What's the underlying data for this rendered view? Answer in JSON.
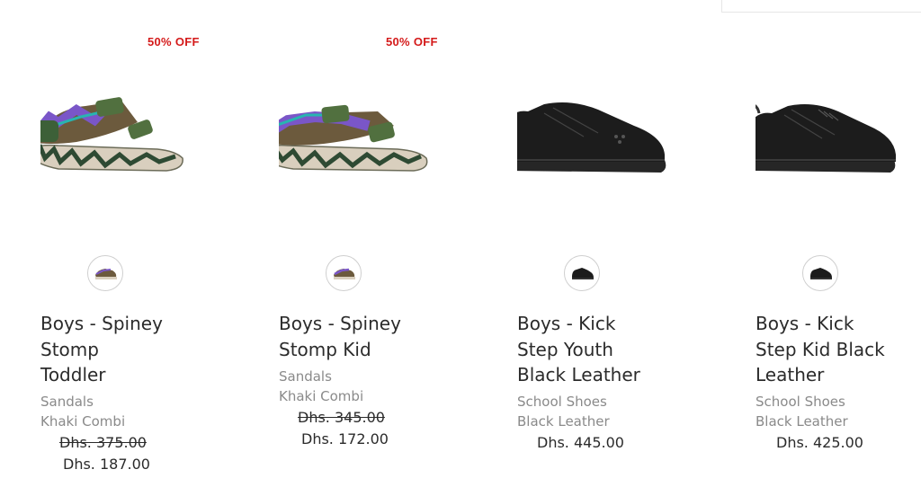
{
  "products": [
    {
      "badge": "50% OFF",
      "name": "Boys - Spiney Stomp Toddler",
      "name_lines": [
        "Boys - Spiney",
        "Stomp",
        "Toddler"
      ],
      "category": "Sandals",
      "color": "Khaki Combi",
      "price_original": "Dhs. 375.00",
      "price": "Dhs. 187.00",
      "image_icon": "sandal-icon"
    },
    {
      "badge": "50% OFF",
      "name": "Boys - Spiney Stomp Kid",
      "name_lines": [
        "Boys - Spiney",
        "Stomp Kid"
      ],
      "category": "Sandals",
      "color": "Khaki Combi",
      "price_original": "Dhs. 345.00",
      "price": "Dhs. 172.00",
      "image_icon": "sandal-icon"
    },
    {
      "badge": "",
      "name": "Boys - Kick Step Youth Black Leather",
      "name_lines": [
        "Boys - Kick",
        "Step Youth",
        "Black Leather"
      ],
      "category": "School Shoes",
      "color": "Black Leather",
      "price_original": "",
      "price": "Dhs. 445.00",
      "image_icon": "shoe-icon"
    },
    {
      "badge": "",
      "name": "Boys - Kick Step Kid Black Leather",
      "name_lines": [
        "Boys - Kick",
        "Step Kid Black",
        "Leather"
      ],
      "category": "School Shoes",
      "color": "Black Leather",
      "price_original": "",
      "price": "Dhs. 425.00",
      "image_icon": "shoe-icon"
    }
  ],
  "colors": {
    "badge": "#d41a1a",
    "text": "#2b2b2b",
    "meta": "#8a8a8a"
  }
}
